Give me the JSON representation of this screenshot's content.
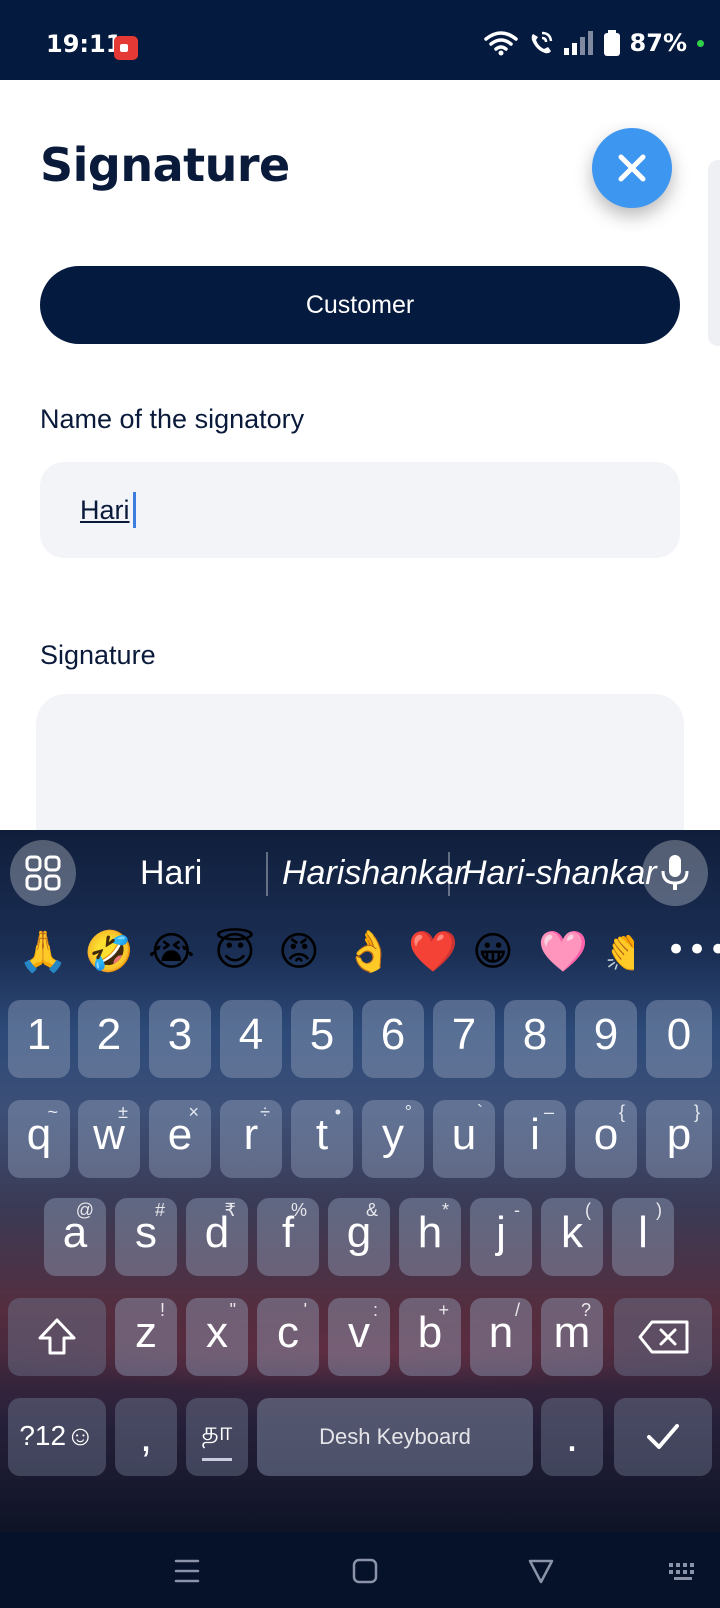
{
  "status_bar": {
    "time": "19:11",
    "battery": "87%",
    "icons": [
      "record-icon",
      "wifi-icon",
      "wifi-call-icon",
      "signal-icon",
      "battery-icon"
    ]
  },
  "page": {
    "title": "Signature",
    "customer_label": "Customer",
    "name_label": "Name of the signatory",
    "name_value": "Hari",
    "signature_label": "Signature"
  },
  "keyboard": {
    "suggestions": [
      "Hari",
      "Harishankar",
      "Hari-shankar"
    ],
    "emojis": [
      "🙏",
      "🤣",
      "😭",
      "😇",
      "😡",
      "👌",
      "❤️",
      "😀",
      "🩷",
      "👏"
    ],
    "more": "•••",
    "number_row": [
      "1",
      "2",
      "3",
      "4",
      "5",
      "6",
      "7",
      "8",
      "9",
      "0"
    ],
    "row1": [
      {
        "k": "q",
        "a": "~"
      },
      {
        "k": "w",
        "a": "±"
      },
      {
        "k": "e",
        "a": "×"
      },
      {
        "k": "r",
        "a": "÷"
      },
      {
        "k": "t",
        "a": "•"
      },
      {
        "k": "y",
        "a": "°"
      },
      {
        "k": "u",
        "a": "`"
      },
      {
        "k": "i",
        "a": "–"
      },
      {
        "k": "o",
        "a": "{"
      },
      {
        "k": "p",
        "a": "}"
      }
    ],
    "row2": [
      {
        "k": "a",
        "a": "@"
      },
      {
        "k": "s",
        "a": "#"
      },
      {
        "k": "d",
        "a": "₹"
      },
      {
        "k": "f",
        "a": "%"
      },
      {
        "k": "g",
        "a": "&"
      },
      {
        "k": "h",
        "a": "*"
      },
      {
        "k": "j",
        "a": "-"
      },
      {
        "k": "k",
        "a": "("
      },
      {
        "k": "l",
        "a": ")"
      }
    ],
    "row3": [
      {
        "k": "z",
        "a": "!"
      },
      {
        "k": "x",
        "a": "\""
      },
      {
        "k": "c",
        "a": "'"
      },
      {
        "k": "v",
        "a": ":"
      },
      {
        "k": "b",
        "a": "+"
      },
      {
        "k": "n",
        "a": "/"
      },
      {
        "k": "m",
        "a": "?"
      }
    ],
    "symbols_key": "?12☺",
    "comma": ",",
    "lang_key": "தா",
    "space_label": "Desh Keyboard",
    "period": "."
  },
  "colors": {
    "navy": "#051a3f",
    "accent_blue": "#3d97f0",
    "field_bg": "#f3f4f8"
  }
}
